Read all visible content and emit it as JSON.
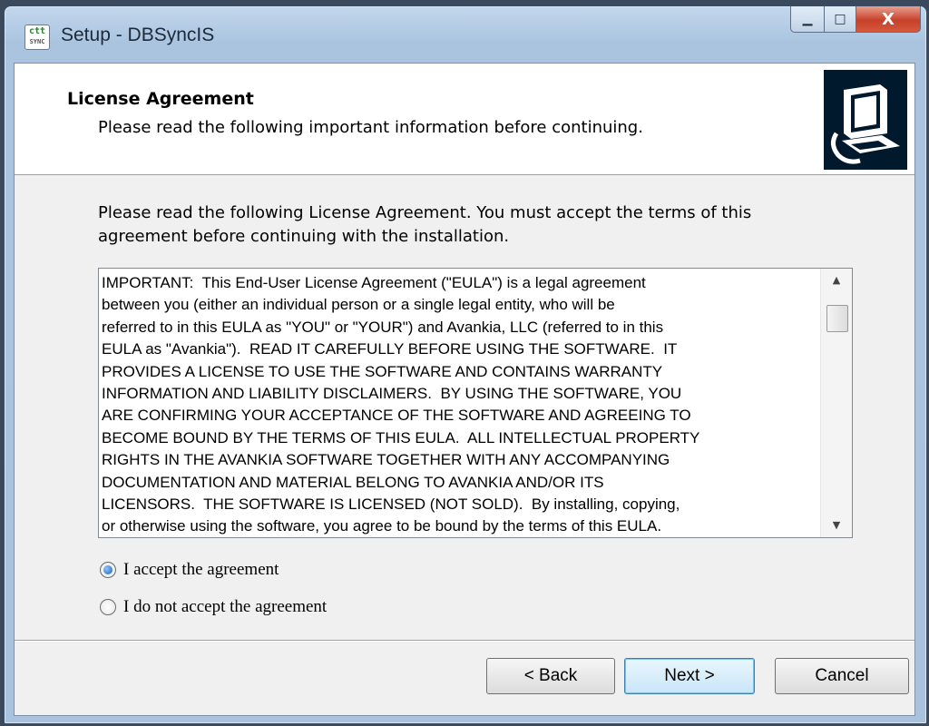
{
  "window": {
    "title": "Setup - DBSyncIS",
    "icon_text": "ctt",
    "icon_subtext": "SYNC",
    "minimize_glyph": "▁",
    "maximize_glyph": "□",
    "close_glyph": "X"
  },
  "header": {
    "title": "License Agreement",
    "subtitle": "Please read the following important information before continuing.",
    "image_icon": "computer-install-icon"
  },
  "intro_text": "Please read the following License Agreement. You must accept the terms of this\nagreement before continuing with the installation.",
  "license_lines": [
    "IMPORTANT:  This End-User License Agreement (\"EULA\") is a legal agreement",
    "between you (either an individual person or a single legal entity, who will be",
    "referred to in this EULA as \"YOU\" or \"YOUR\") and Avankia, LLC (referred to in this",
    "EULA as \"Avankia\").  READ IT CAREFULLY BEFORE USING THE SOFTWARE.  IT",
    "PROVIDES A LICENSE TO USE THE SOFTWARE AND CONTAINS WARRANTY",
    "INFORMATION AND LIABILITY DISCLAIMERS.  BY USING THE SOFTWARE, YOU",
    "ARE CONFIRMING YOUR ACCEPTANCE OF THE SOFTWARE AND AGREEING TO",
    "BECOME BOUND BY THE TERMS OF THIS EULA.  ALL INTELLECTUAL PROPERTY",
    "RIGHTS IN THE AVANKIA SOFTWARE TOGETHER WITH ANY ACCOMPANYING",
    "DOCUMENTATION AND MATERIAL BELONG TO AVANKIA AND/OR ITS",
    "LICENSORS.  THE SOFTWARE IS LICENSED (NOT SOLD).  By installing, copying,",
    "or otherwise using the software, you agree to be bound by the terms of this EULA."
  ],
  "scrollbar": {
    "up_glyph": "▲",
    "down_glyph": "▼"
  },
  "options": {
    "accept_label": "I accept the agreement",
    "decline_label": "I do not accept the agreement",
    "selected": "accept"
  },
  "buttons": {
    "back": "< Back",
    "next": "Next >",
    "cancel": "Cancel"
  },
  "colors": {
    "title_bar": "#aac4e0",
    "client_bg": "#f0f0f0",
    "close_button": "#c7402a",
    "default_button_border": "#3c7fb1"
  }
}
